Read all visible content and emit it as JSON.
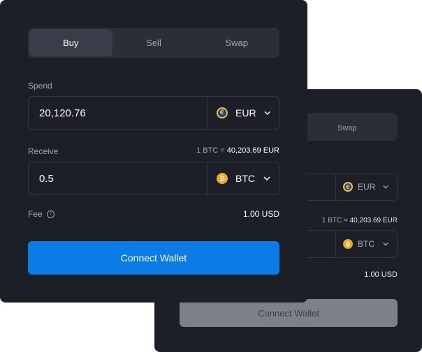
{
  "colors": {
    "card_bg": "#1c1f27",
    "accent": "#0b7ce6",
    "disabled_button": "#7c8087"
  },
  "widget": {
    "tabs": [
      {
        "label": "Buy",
        "active": true
      },
      {
        "label": "Sell",
        "active": false
      },
      {
        "label": "Swap",
        "active": false
      }
    ],
    "spend": {
      "label": "Spend",
      "amount": "20,120.76",
      "currency": "EUR",
      "currency_symbol": "€",
      "currency_icon": "euro-coin-icon"
    },
    "receive": {
      "label": "Receive",
      "rate_prefix": "1 BTC =",
      "rate_value": "40,203.69 EUR",
      "amount": "0.5",
      "currency": "BTC",
      "currency_symbol": "₿",
      "currency_icon": "bitcoin-coin-icon"
    },
    "fee": {
      "label": "Fee",
      "info_icon": "info-icon",
      "value": "1.00 USD"
    },
    "connect_label": "Connect Wallet"
  },
  "background_widget": {
    "tab_label": "Swap",
    "spend_currency": "EUR",
    "rate_prefix": "1 BTC =",
    "rate_value": "40,203.69 EUR",
    "receive_currency": "BTC",
    "fee_value": "1.00 USD",
    "connect_label": "Connect Wallet"
  }
}
